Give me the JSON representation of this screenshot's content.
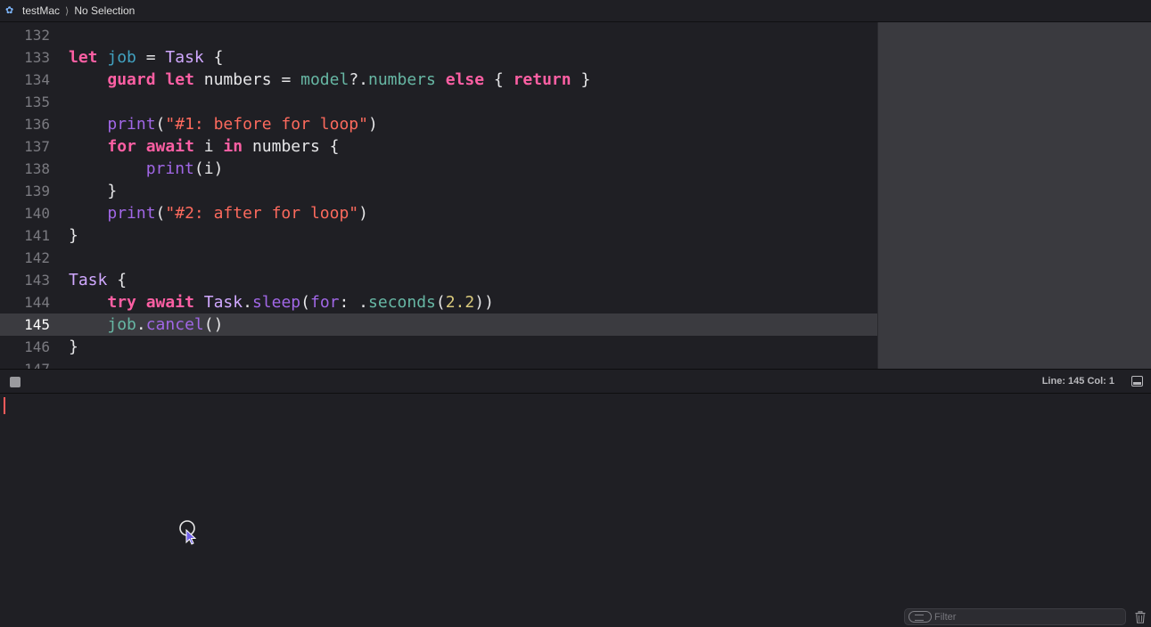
{
  "jumpbar": {
    "project": "testMac",
    "selection": "No Selection"
  },
  "editor": {
    "lines": [
      {
        "num": "132",
        "tokens": []
      },
      {
        "num": "133",
        "tokens": [
          [
            "kw",
            "let"
          ],
          [
            "p",
            " "
          ],
          [
            "id",
            "job"
          ],
          [
            "p",
            " = "
          ],
          [
            "type",
            "Task"
          ],
          [
            "p",
            " {"
          ]
        ]
      },
      {
        "num": "134",
        "tokens": [
          [
            "p",
            "    "
          ],
          [
            "kw",
            "guard"
          ],
          [
            "p",
            " "
          ],
          [
            "kw",
            "let"
          ],
          [
            "p",
            " numbers = "
          ],
          [
            "prop",
            "model"
          ],
          [
            "p",
            "?."
          ],
          [
            "prop",
            "numbers"
          ],
          [
            "p",
            " "
          ],
          [
            "kw",
            "else"
          ],
          [
            "p",
            " { "
          ],
          [
            "kw",
            "return"
          ],
          [
            "p",
            " }"
          ]
        ]
      },
      {
        "num": "135",
        "tokens": []
      },
      {
        "num": "136",
        "tokens": [
          [
            "p",
            "    "
          ],
          [
            "fn",
            "print"
          ],
          [
            "p",
            "("
          ],
          [
            "str",
            "\"#1: before for loop\""
          ],
          [
            "p",
            ")"
          ]
        ]
      },
      {
        "num": "137",
        "tokens": [
          [
            "p",
            "    "
          ],
          [
            "kw",
            "for"
          ],
          [
            "p",
            " "
          ],
          [
            "kw",
            "await"
          ],
          [
            "p",
            " i "
          ],
          [
            "kw",
            "in"
          ],
          [
            "p",
            " numbers {"
          ]
        ]
      },
      {
        "num": "138",
        "tokens": [
          [
            "p",
            "        "
          ],
          [
            "fn",
            "print"
          ],
          [
            "p",
            "(i)"
          ]
        ]
      },
      {
        "num": "139",
        "tokens": [
          [
            "p",
            "    }"
          ]
        ]
      },
      {
        "num": "140",
        "tokens": [
          [
            "p",
            "    "
          ],
          [
            "fn",
            "print"
          ],
          [
            "p",
            "("
          ],
          [
            "str",
            "\"#2: after for loop\""
          ],
          [
            "p",
            ")"
          ]
        ]
      },
      {
        "num": "141",
        "tokens": [
          [
            "p",
            "}"
          ]
        ]
      },
      {
        "num": "142",
        "tokens": []
      },
      {
        "num": "143",
        "tokens": [
          [
            "type",
            "Task"
          ],
          [
            "p",
            " {"
          ]
        ]
      },
      {
        "num": "144",
        "tokens": [
          [
            "p",
            "    "
          ],
          [
            "kw",
            "try"
          ],
          [
            "p",
            " "
          ],
          [
            "kw",
            "await"
          ],
          [
            "p",
            " "
          ],
          [
            "type",
            "Task"
          ],
          [
            "p",
            "."
          ],
          [
            "fn",
            "sleep"
          ],
          [
            "p",
            "("
          ],
          [
            "fn",
            "for"
          ],
          [
            "p",
            ": ."
          ],
          [
            "prop",
            "seconds"
          ],
          [
            "p",
            "("
          ],
          [
            "num",
            "2.2"
          ],
          [
            "p",
            "))"
          ]
        ]
      },
      {
        "num": "145",
        "current": true,
        "tokens": [
          [
            "p",
            "    "
          ],
          [
            "prop",
            "job"
          ],
          [
            "p",
            "."
          ],
          [
            "fn",
            "cancel"
          ],
          [
            "p",
            "()"
          ]
        ]
      },
      {
        "num": "146",
        "tokens": [
          [
            "p",
            "}"
          ]
        ]
      },
      {
        "num": "147",
        "tokens": []
      }
    ]
  },
  "status": {
    "line_col": "Line: 145  Col: 1"
  },
  "console": {
    "filter_placeholder": "Filter",
    "filter_value": ""
  },
  "icons": {
    "swift": "swift-icon",
    "stop": "stop-icon",
    "panel": "panel-toggle-icon",
    "filter": "filter-icon",
    "trash": "trash-icon",
    "cursor": "mouse-pointer-icon"
  }
}
